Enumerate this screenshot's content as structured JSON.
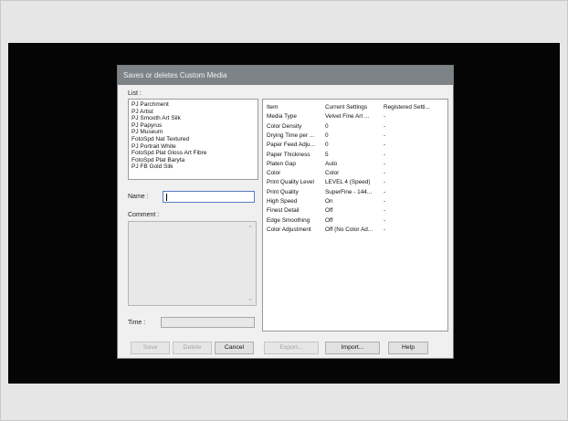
{
  "dialog": {
    "title": "Saves or deletes Custom Media",
    "list_label": "List :",
    "list_items": [
      "PJ Parchment",
      "PJ Artist",
      "PJ Smooth Art Silk",
      "PJ Papyrus",
      "PJ Museum",
      "FotoSpd Nat Textured",
      "PJ Portrait White",
      "FotoSpd Plat Gloss Art Fibre",
      "FotoSpd Plat Baryta",
      "PJ FB Gold Silk"
    ],
    "name_label": "Name :",
    "name_value": "",
    "comment_label": "Comment :",
    "time_label": "Time :",
    "table": {
      "headers": [
        "Item",
        "Current Settings",
        "Registered Setti..."
      ],
      "rows": [
        [
          "Media Type",
          "Velvet Fine Art ...",
          "-"
        ],
        [
          "Color Density",
          "0",
          "-"
        ],
        [
          "Drying Time per ...",
          "0",
          "-"
        ],
        [
          "Paper Feed Adju...",
          "0",
          "-"
        ],
        [
          "Paper Thickness",
          "5",
          "-"
        ],
        [
          "Platen Gap",
          "Auto",
          "-"
        ],
        [
          "Color",
          "Color",
          "-"
        ],
        [
          "Print Quality Level",
          "LEVEL 4 (Speed)",
          "-"
        ],
        [
          "Print Quality",
          "SuperFine - 144...",
          "-"
        ],
        [
          "High Speed",
          "On",
          "-"
        ],
        [
          "Finest Detail",
          "Off",
          "-"
        ],
        [
          "Edge Smoothing",
          "Off",
          "-"
        ],
        [
          "Color Adjustment",
          "Off (No Color Ad...",
          "-"
        ]
      ]
    },
    "buttons": {
      "save": "Save",
      "delete": "Delete",
      "cancel": "Cancel",
      "export": "Export...",
      "import": "Import...",
      "help": "Help"
    }
  },
  "colors": {
    "titlebar": "#7e8387",
    "backdrop": "#050505",
    "dialog_bg": "#f0f0f0"
  },
  "icons": [
    "scroll-up-arrow-icon",
    "scroll-down-arrow-icon"
  ]
}
